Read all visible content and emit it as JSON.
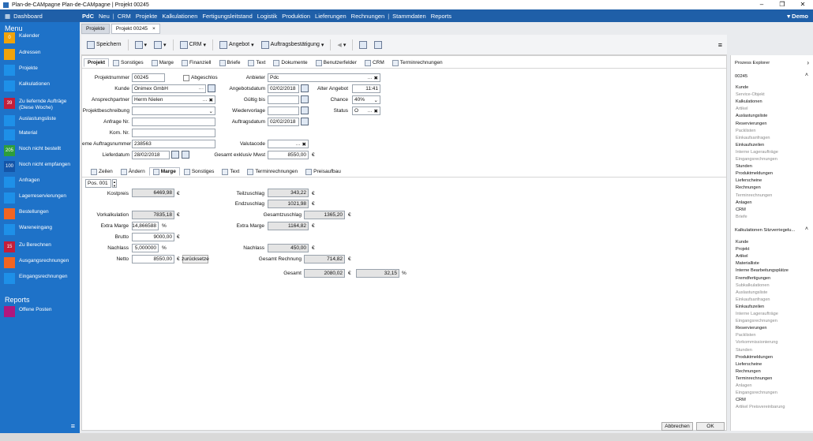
{
  "window": {
    "title": "Plan-de-CAMpagne  Plan-de-CAMpagne | Projekt 00245",
    "user": "Demo"
  },
  "menubar": {
    "dashboard": "Dashboard",
    "items": [
      "PdC",
      "Neu",
      "|",
      "CRM",
      "Projekte",
      "Kalkulationen",
      "Fertigungsleitstand",
      "Logistik",
      "Produktion",
      "Lieferungen",
      "Rechnungen",
      "|",
      "Stammdaten",
      "Reports"
    ]
  },
  "sidebar": {
    "menu_title": "Menu",
    "items": [
      {
        "label": "Kalender",
        "badge": "0",
        "color": "#f0a30a"
      },
      {
        "label": "Adressen",
        "badge": "",
        "color": "#f0a30a"
      },
      {
        "label": "Projekte",
        "badge": "",
        "color": "#1e90e8"
      },
      {
        "label": "Kalkulationen",
        "badge": "",
        "color": "#1e90e8"
      },
      {
        "label": "Zu liefernde Aufträge (Diese Woche)",
        "badge": "39",
        "color": "#c41e3a"
      },
      {
        "label": "Auslastungsliste",
        "badge": "",
        "color": "#1e90e8"
      },
      {
        "label": "Material",
        "badge": "",
        "color": "#1e90e8"
      },
      {
        "label": "Noch nicht bestellt",
        "badge": "205",
        "color": "#2e9e3c"
      },
      {
        "label": "Noch nicht empfangen",
        "badge": "100",
        "color": "#1455a8"
      },
      {
        "label": "Anfragen",
        "badge": "",
        "color": "#1e90e8"
      },
      {
        "label": "Lagerreservierungen",
        "badge": "",
        "color": "#1e90e8"
      },
      {
        "label": "Bestellungen",
        "badge": "",
        "color": "#f26522"
      },
      {
        "label": "Wareneingang",
        "badge": "",
        "color": "#1e90e8"
      },
      {
        "label": "Zu Berechnen",
        "badge": "15",
        "color": "#c41e3a"
      },
      {
        "label": "Ausgangsrechnungen",
        "badge": "",
        "color": "#f26522"
      },
      {
        "label": "Eingangsrechnungen",
        "badge": "",
        "color": "#1e90e8"
      }
    ],
    "reports_title": "Reports",
    "reports": [
      {
        "label": "Offene Posten",
        "color": "#b0177d"
      }
    ]
  },
  "tabs": [
    {
      "label": "Projekte"
    },
    {
      "label": "Projekt 00245",
      "close": "×"
    }
  ],
  "toolbar": {
    "save": "Speichern",
    "crm": "CRM",
    "angebot": "Angebot",
    "auftrag": "Auftragsbestätigung"
  },
  "top_tabs": [
    "Projekt",
    "Sonstiges",
    "Marge",
    "Finanziell",
    "Briefe",
    "Text",
    "Dokumente",
    "Benutzerfelder",
    "CRM",
    "Terminrechnungen"
  ],
  "form": {
    "projektnummer_label": "Projektnummer",
    "projektnummer": "00245",
    "abgeschlossen_label": "Abgeschlos",
    "kunde_label": "Kunde",
    "kunde": "Onimex GmbH",
    "ansprechpartner_label": "Ansprechpartner",
    "ansprechpartner": "Herrn Nielen",
    "projektbeschreibung_label": "Projektbeschreibung",
    "projektbeschreibung": "",
    "anfrage_label": "Anfrage Nr.",
    "anfrage": "",
    "kom_label": "Kom. Nr.",
    "kom": "",
    "externe_label": "eme Auftragsnummer",
    "externe": "238563",
    "lieferdatum_label": "Lieferdatum",
    "lieferdatum": "28/02/2018",
    "anbieter_label": "Anbieter",
    "anbieter": "Pdc",
    "angebotsdatum_label": "Angebotsdatum",
    "angebotsdatum": "02/02/2018",
    "gueltig_label": "Gültig bis",
    "gueltig": "",
    "wiedervorlage_label": "Wiedervorlage",
    "wiedervorlage": "",
    "auftragsdatum_label": "Auftragsdatum",
    "auftragsdatum": "02/02/2018",
    "valutacode_label": "Valutacode",
    "valutacode": "",
    "gesamt_exkl_label": "Gesamt exklusiv Mwst",
    "gesamt_exkl": "8550,00",
    "euro": "€",
    "alter_label": "Alter Angebot",
    "alter": "11:41",
    "chance_label": "Chance",
    "chance": "40%",
    "status_label": "Status",
    "status": "O"
  },
  "sub_tabs": [
    "Zeilen",
    "Ändern",
    "Marge",
    "Sonstiges",
    "Text",
    "Terminrechnungen",
    "Preisaufbau"
  ],
  "marge": {
    "pos": "Pos. 001",
    "kostpreis_label": "Kostpreis",
    "kostpreis": "6469,98",
    "vorkalkulation_label": "Vorkalkulation",
    "vorkalkulation": "7835,18",
    "extra_marge_label": "Extra Marge",
    "extra_marge_pct": "14,866588",
    "pct": "%",
    "brutto_label": "Brutto",
    "brutto": "9000,00",
    "nachlass_label": "Nachlass",
    "nachlass_pct": "5,000000",
    "netto_label": "Netto",
    "netto": "8550,00",
    "zurueck": "zurücksetze",
    "teilzuschlag_label": "Teilzuschlag",
    "teilzuschlag": "343,22",
    "endzuschlag_label": "Endzuschlag",
    "endzuschlag": "1021,98",
    "gesamtzuschlag_label": "Gesamtzuschlag",
    "gesamtzuschlag": "1365,20",
    "extra_marge2_label": "Extra Marge",
    "extra_marge2": "1164,82",
    "nachlass2_label": "Nachlass",
    "nachlass2": "450,00",
    "gesamt_rechnung_label": "Gesamt Rechnung",
    "gesamt_rechnung": "714,82",
    "gesamt_label": "Gesamt",
    "gesamt": "2080,02",
    "gesamt_pct": "32,15"
  },
  "explorer": {
    "title": "Prozess Explorer",
    "sec1": "00245",
    "sec1_items": [
      {
        "t": "Kunde",
        "d": false
      },
      {
        "t": "Service-Objekt",
        "d": true
      },
      {
        "t": "Kalkulationen",
        "d": false
      },
      {
        "t": "Artikel",
        "d": true
      },
      {
        "t": "Auslastungsliste",
        "d": false
      },
      {
        "t": "Reservierungen",
        "d": false
      },
      {
        "t": "Packlisten",
        "d": true
      },
      {
        "t": "Einkaufsanfragen",
        "d": true
      },
      {
        "t": "Einkaufszeilen",
        "d": false
      },
      {
        "t": "Interne Lageraufträge",
        "d": true
      },
      {
        "t": "Eingangsrechnungen",
        "d": true
      },
      {
        "t": "Stunden",
        "d": false
      },
      {
        "t": "Produktmeldungen",
        "d": false
      },
      {
        "t": "Lieferscheine",
        "d": false
      },
      {
        "t": "Rechnungen",
        "d": false
      },
      {
        "t": "Terminrechnungen",
        "d": true
      },
      {
        "t": "Anlagen",
        "d": false
      },
      {
        "t": "CRM",
        "d": false
      },
      {
        "t": "Briefe",
        "d": true
      }
    ],
    "sec2": "Kalkulationen Sitzverriegelu...",
    "sec2_items": [
      {
        "t": "Kunde",
        "d": false
      },
      {
        "t": "Projekt",
        "d": false
      },
      {
        "t": "Artikel",
        "d": false
      },
      {
        "t": "Materialliste",
        "d": false
      },
      {
        "t": "Interne Bearbeitungsplätze",
        "d": false
      },
      {
        "t": "Fremdfertigungen",
        "d": false
      },
      {
        "t": "Subkalkulationen",
        "d": true
      },
      {
        "t": "Auslastungsliste",
        "d": true
      },
      {
        "t": "Einkaufsanfragen",
        "d": true
      },
      {
        "t": "Einkaufszeilen",
        "d": false
      },
      {
        "t": "Interne Lageraufträge",
        "d": true
      },
      {
        "t": "Eingangsrechnungen",
        "d": true
      },
      {
        "t": "Reservierungen",
        "d": false
      },
      {
        "t": "Packlisten",
        "d": true
      },
      {
        "t": "Vorkommissionierung",
        "d": true
      },
      {
        "t": "Stunden",
        "d": true
      },
      {
        "t": "Produktmeldungen",
        "d": false
      },
      {
        "t": "Lieferscheine",
        "d": false
      },
      {
        "t": "Rechnungen",
        "d": false
      },
      {
        "t": "Terminrechnungen",
        "d": false
      },
      {
        "t": "Anlagen",
        "d": true
      },
      {
        "t": "Eingangsrechnungen",
        "d": true
      },
      {
        "t": "CRM",
        "d": false
      },
      {
        "t": "Artikel Preisvereinbarung",
        "d": true
      }
    ]
  },
  "buttons": {
    "abbrechen": "Abbrechen",
    "ok": "OK"
  }
}
